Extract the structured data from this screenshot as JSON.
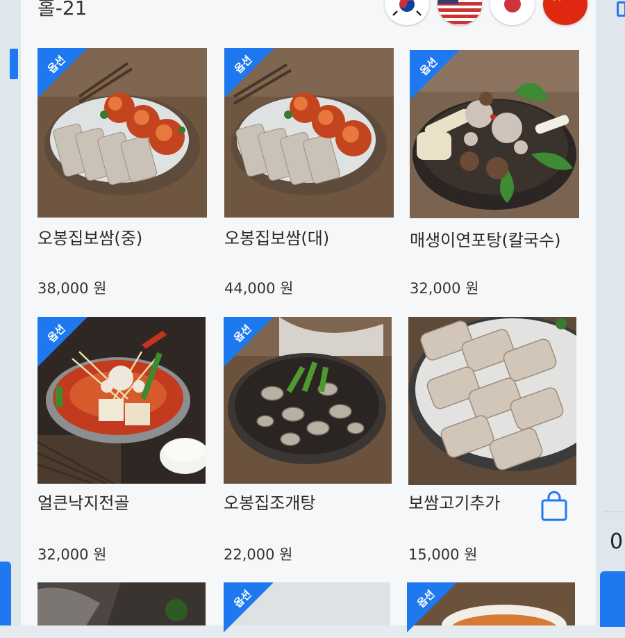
{
  "header": {
    "title": "홀-21"
  },
  "languages": [
    {
      "name": "korean-flag-icon",
      "code": "ko"
    },
    {
      "name": "us-flag-icon",
      "code": "en"
    },
    {
      "name": "japan-flag-icon",
      "code": "ja"
    },
    {
      "name": "china-flag-icon",
      "code": "zh"
    }
  ],
  "badge_label": "옵션",
  "menu_items": [
    {
      "name": "오봉집보쌈(중)",
      "price": "38,000 원",
      "option": true
    },
    {
      "name": "오봉집보쌈(대)",
      "price": "44,000 원",
      "option": true
    },
    {
      "name": "매생이연포탕(칼국수)",
      "price": "32,000 원",
      "option": true
    },
    {
      "name": "얼큰낙지전골",
      "price": "32,000 원",
      "option": true
    },
    {
      "name": "오봉집조개탕",
      "price": "22,000 원",
      "option": true
    },
    {
      "name": "보쌈고기추가",
      "price": "15,000 원",
      "option": false
    },
    {
      "name": "",
      "price": "",
      "option": false
    },
    {
      "name": "",
      "price": "",
      "option": true
    },
    {
      "name": "",
      "price": "",
      "option": true
    }
  ],
  "side": {
    "right_text": "0"
  },
  "colors": {
    "accent": "#1e78f0",
    "panel": "#f5f7f9"
  }
}
